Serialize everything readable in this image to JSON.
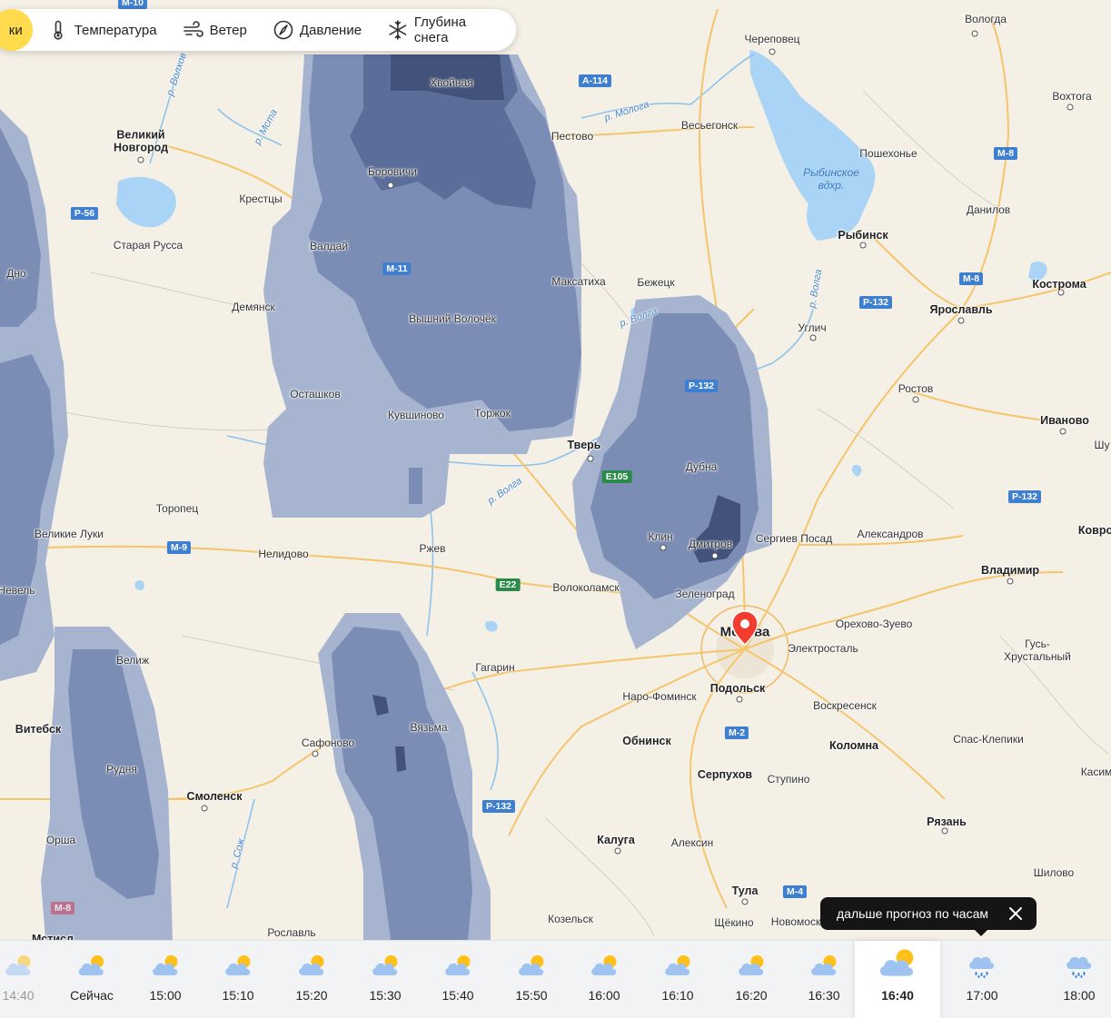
{
  "toolbar": {
    "first_partial": "ки",
    "items": [
      {
        "label": "Температура",
        "icon": "thermometer-icon"
      },
      {
        "label": "Ветер",
        "icon": "wind-icon"
      },
      {
        "label": "Давление",
        "icon": "compass-icon"
      },
      {
        "label": "Глубина снега",
        "icon": "snowflake-icon"
      }
    ]
  },
  "map": {
    "cities": {
      "vologda": "Вологда",
      "cherepovets": "Череповец",
      "vokhtoga": "Вохтога",
      "khvoynaya": "Хвойная",
      "pestovo": "Пестово",
      "vesyegonsk": "Весьегонск",
      "poshekhonye": "Пошехонье",
      "veliky_novgorod": "Великий Новгород",
      "borovichi": "Боровичи",
      "kresttsy": "Крестцы",
      "danilov": "Данилов",
      "rybinsk": "Рыбинск",
      "staraya_russa": "Старая Русса",
      "valday": "Валдай",
      "kostroma": "Кострома",
      "dno": "Дно",
      "maksatikha": "Максатиха",
      "bezhetsk": "Бежецк",
      "demyansk": "Демянск",
      "vyshny_volochek": "Вышний Волочёк",
      "yaroslavl": "Ярославль",
      "uglich": "Углич",
      "ostashkov": "Осташков",
      "kuvshinovo": "Кувшиново",
      "torzhok": "Торжок",
      "rostov": "Ростов",
      "ivanovo": "Иваново",
      "shu": "Шу",
      "tver": "Тверь",
      "dubna": "Дубна",
      "toropets": "Торопец",
      "velikie_luki": "Великие Луки",
      "klin": "Клин",
      "dmitrov": "Дмитров",
      "sergiev_posad": "Сергиев Посад",
      "aleksandrov": "Александров",
      "kovrov": "Ковро",
      "nelidovo": "Нелидово",
      "rzhev": "Ржев",
      "vladimir": "Владимир",
      "volokolamsk": "Волоколамск",
      "zelenograd": "Зеленоград",
      "nevel": "Невель",
      "moskva": "Москва",
      "orekhovo_zuevo": "Орехово-Зуево",
      "elektrostal": "Электросталь",
      "gus_khrustalny": "Гусь-Хрустальный",
      "velizh": "Велиж",
      "gagarin": "Гагарин",
      "naro_fominsk": "Наро-Фоминск",
      "podolsk": "Подольск",
      "voskresensk": "Воскресенск",
      "vitebsk": "Витебск",
      "vyazma": "Вязьма",
      "obninsk": "Обнинск",
      "spas_klepiki": "Спас-Клепики",
      "safonovo": "Сафоново",
      "kolomna": "Коломна",
      "rudnya": "Рудня",
      "kasimov": "Касим",
      "serpukhov": "Серпухов",
      "stupino": "Ступино",
      "smolensk": "Смоленск",
      "ryazan": "Рязань",
      "orsha": "Орша",
      "kaluga": "Калуга",
      "aleksin": "Алексин",
      "shilovo": "Шилово",
      "tula": "Тула",
      "kozelsk": "Козельск",
      "shchekino": "Щёкино",
      "novomoskovsk": "Новомоск",
      "roslavl": "Рославль",
      "mstislavl": "Мстисл"
    },
    "water": {
      "rybinsk_reservoir": "Рыбинское вдхр."
    },
    "rivers": {
      "volkhov": "р. Волхов",
      "msta": "р. Мста",
      "mologa": "р. Молога",
      "volga_east": "р. Волга",
      "volga_tver": "р. Волга",
      "volga_uglich": "р. Волга",
      "sozh": "р. Сож"
    },
    "roads": {
      "m10": "М-10",
      "a114": "А-114",
      "m8_north": "М-8",
      "p56": "Р-56",
      "m11": "М-11",
      "m8_yar": "М-8",
      "p132_north": "Р-132",
      "p132_dmitrov": "Р-132",
      "e105": "Е105",
      "p132_east": "Р-132",
      "m9": "М-9",
      "e22": "Е22",
      "m2": "М-2",
      "p132_south": "Р-132",
      "m4": "М-4",
      "m8_west": "М-8"
    },
    "accent_pin": "#f33b2f",
    "precip_colors": [
      "#a6b4cf",
      "#7b8db5",
      "#5b6d99",
      "#43527a"
    ]
  },
  "tooltip": {
    "text": "дальше прогноз по часам",
    "close_icon": "close-icon"
  },
  "timeline": {
    "slots": [
      {
        "time": "14:40",
        "icon": "partly-cloudy-icon"
      },
      {
        "time": "Сейчас",
        "icon": "partly-cloudy-icon"
      },
      {
        "time": "15:00",
        "icon": "partly-cloudy-icon"
      },
      {
        "time": "15:10",
        "icon": "partly-cloudy-icon"
      },
      {
        "time": "15:20",
        "icon": "partly-cloudy-icon"
      },
      {
        "time": "15:30",
        "icon": "partly-cloudy-icon"
      },
      {
        "time": "15:40",
        "icon": "partly-cloudy-icon"
      },
      {
        "time": "15:50",
        "icon": "partly-cloudy-icon"
      },
      {
        "time": "16:00",
        "icon": "partly-cloudy-icon"
      },
      {
        "time": "16:10",
        "icon": "partly-cloudy-icon"
      },
      {
        "time": "16:20",
        "icon": "partly-cloudy-icon"
      },
      {
        "time": "16:30",
        "icon": "partly-cloudy-icon"
      },
      {
        "time": "16:40",
        "icon": "partly-cloudy-icon"
      },
      {
        "time": "17:00",
        "icon": "rain-cloud-icon"
      },
      {
        "time": "18:00",
        "icon": "rain-cloud-icon"
      }
    ]
  }
}
